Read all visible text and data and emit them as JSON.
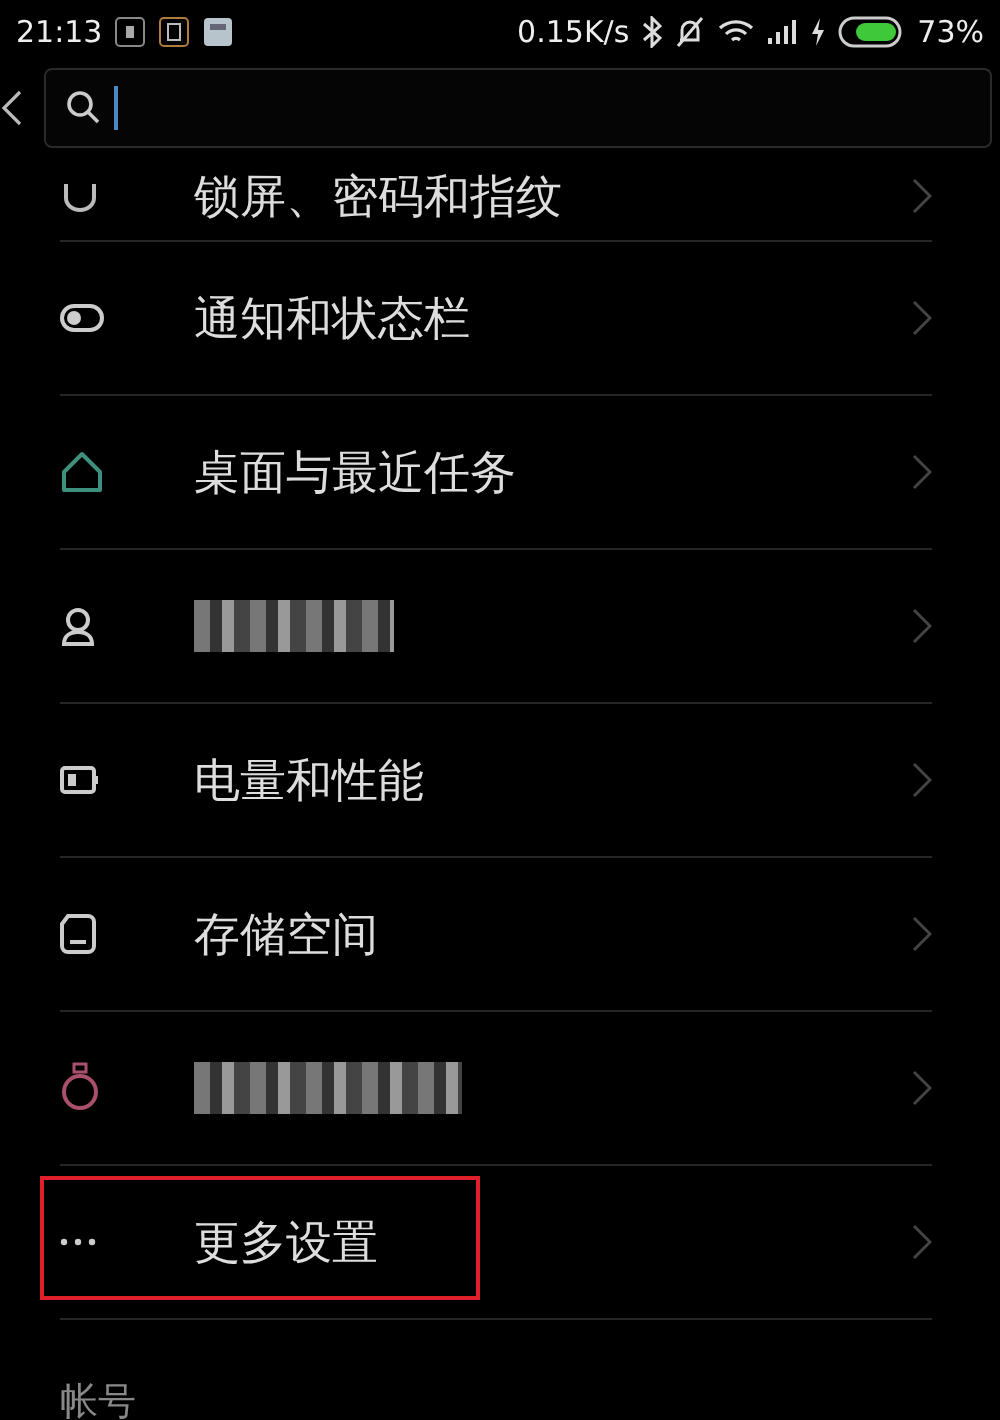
{
  "status_bar": {
    "time": "21:13",
    "network_speed": "0.15K/s",
    "battery_percent": "73%"
  },
  "settings_list": [
    {
      "kind": "label",
      "label": "锁屏、密码和指纹",
      "highlighted": false
    },
    {
      "kind": "label",
      "label": "通知和状态栏",
      "highlighted": false
    },
    {
      "kind": "label",
      "label": "桌面与最近任务",
      "highlighted": false
    },
    {
      "kind": "redacted",
      "highlighted": false
    },
    {
      "kind": "label",
      "label": "电量和性能",
      "highlighted": false
    },
    {
      "kind": "label",
      "label": "存储空间",
      "highlighted": false
    },
    {
      "kind": "redacted",
      "highlighted": false
    },
    {
      "kind": "label",
      "label": "更多设置",
      "highlighted": true
    }
  ],
  "section_header": "帐号"
}
